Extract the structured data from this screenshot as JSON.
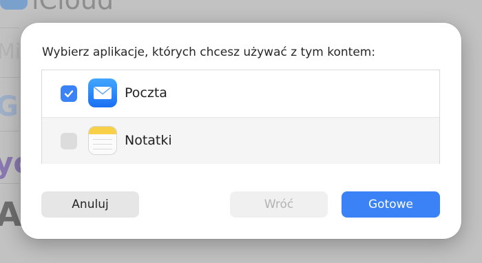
{
  "background": {
    "texts": [
      "iCloud",
      "Mic",
      "G",
      "yo",
      "A"
    ]
  },
  "dialog": {
    "prompt": "Wybierz aplikacje, których chcesz używać z tym kontem:",
    "apps": [
      {
        "label": "Poczta",
        "checked": true,
        "icon": "mail-icon"
      },
      {
        "label": "Notatki",
        "checked": false,
        "icon": "notes-icon"
      }
    ],
    "buttons": {
      "cancel": "Anuluj",
      "back": "Wróć",
      "done": "Gotowe"
    }
  },
  "colors": {
    "accent": "#3a82f6",
    "disabled_text": "#b3b3b3"
  }
}
